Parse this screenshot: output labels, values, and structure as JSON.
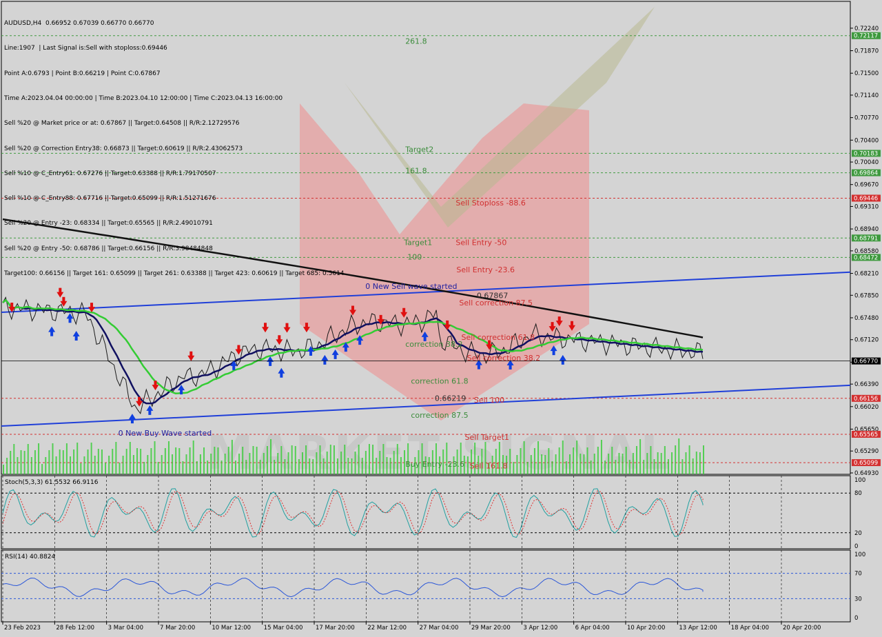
{
  "header": {
    "lines": [
      "AUDUSD,H4  0.66952 0.67039 0.66770 0.66770",
      "Line:1907  | Last Signal is:Sell with stoploss:0.69446",
      "Point A:0.6793 | Point B:0.66219 | Point C:0.67867",
      "Time A:2023.04.04 00:00:00 | Time B:2023.04.10 12:00:00 | Time C:2023.04.13 16:00:00",
      "Sell %20 @ Market price or at: 0.67867 || Target:0.64508 || R/R:2.12729576",
      "Sell %20 @ Correction Entry38: 0.66873 || Target:0.60619 || R/R:2.43062573",
      "Sell %10 @ C_Entry61: 0.67276 || Target:0.63388 || R/R:1.79170507",
      "Sell %10 @ C_Entry88: 0.67716 || Target:0.65099 || R/R:1.51271676",
      "Sell %20 @ Entry -23: 0.68334 || Target:0.65565 || R/R:2.49010791",
      "Sell %20 @ Entry -50: 0.68786 || Target:0.66156 || R/R:3.98484848",
      "Target100: 0.66156 || Target 161: 0.65099 || Target 261: 0.63388 || Target 423: 0.60619 || Target 685: 0.5614"
    ]
  },
  "chart_data": {
    "type": "line",
    "symbol": "AUDUSD,H4",
    "ohlc": {
      "open": 0.66952,
      "high": 0.67039,
      "low": 0.6677,
      "close": 0.6677
    },
    "price_axis": {
      "ylim": [
        0.6493,
        0.7242
      ],
      "ticks": [
        "0.72240",
        "0.71870",
        "0.71500",
        "0.71140",
        "0.70770",
        "0.70400",
        "0.70040",
        "0.69670",
        "0.69310",
        "0.68940",
        "0.68580",
        "0.68210",
        "0.67850",
        "0.67480",
        "0.67120",
        "0.66750",
        "0.66390",
        "0.66020",
        "0.65650",
        "0.65290",
        "0.64930"
      ]
    },
    "time_axis": [
      "23 Feb 2023",
      "28 Feb 12:00",
      "3 Mar 04:00",
      "7 Mar 20:00",
      "10 Mar 12:00",
      "15 Mar 04:00",
      "17 Mar 20:00",
      "22 Mar 12:00",
      "27 Mar 04:00",
      "29 Mar 20:00",
      "3 Apr 12:00",
      "6 Apr 04:00",
      "10 Apr 20:00",
      "13 Apr 12:00",
      "18 Apr 04:00",
      "20 Apr 20:00"
    ],
    "current_price": {
      "value": 0.6677,
      "label": "0.66770",
      "color": "#000000"
    },
    "levels": [
      {
        "value": 0.72117,
        "label": "0.72117",
        "color": "#3f9a3f",
        "dash": true
      },
      {
        "value": 0.70183,
        "label": "0.70183",
        "color": "#3f9a3f",
        "dash": true
      },
      {
        "value": 0.69864,
        "label": "0.69864",
        "color": "#3f9a3f",
        "dash": true
      },
      {
        "value": 0.69446,
        "label": "0.69446",
        "color": "#d33030",
        "dash": true
      },
      {
        "value": 0.68791,
        "label": "0.68791",
        "color": "#3f9a3f",
        "dash": true
      },
      {
        "value": 0.68472,
        "label": "0.68472",
        "color": "#3f9a3f",
        "dash": true
      },
      {
        "value": 0.66156,
        "label": "0.66156",
        "color": "#d33030",
        "dash": true
      },
      {
        "value": 0.65565,
        "label": "0.65565",
        "color": "#d33030",
        "dash": true
      },
      {
        "value": 0.65099,
        "label": "0.65099",
        "color": "#d33030",
        "dash": true
      }
    ],
    "annotations": [
      {
        "text": "261.8",
        "value": 0.7203,
        "time": 0.575,
        "color": "#3c8c3c"
      },
      {
        "text": "Target2",
        "value": 0.7025,
        "time": 0.575,
        "color": "#3c8c3c"
      },
      {
        "text": "161.8",
        "value": 0.699,
        "time": 0.575,
        "color": "#3c8c3c"
      },
      {
        "text": "Sell Stoploss -88.6",
        "value": 0.6937,
        "time": 0.647,
        "color": "#d03030"
      },
      {
        "text": "Target1",
        "value": 0.6872,
        "time": 0.573,
        "color": "#3c8c3c"
      },
      {
        "text": "Sell Entry -50",
        "value": 0.6872,
        "time": 0.647,
        "color": "#d03030"
      },
      {
        "text": "100",
        "value": 0.6848,
        "time": 0.578,
        "color": "#3c8c3c"
      },
      {
        "text": "Sell Entry -23.6",
        "value": 0.6827,
        "time": 0.648,
        "color": "#d03030"
      },
      {
        "text": "0 New Sell wave started",
        "value": 0.68,
        "time": 0.518,
        "color": "#2020a0"
      },
      {
        "text": "0.67867",
        "value": 0.6785,
        "time": 0.677,
        "color": "#303030"
      },
      {
        "text": "Sell correction 87.5",
        "value": 0.6773,
        "time": 0.652,
        "color": "#d03030"
      },
      {
        "text": "Sell correction 61.8",
        "value": 0.6716,
        "time": 0.655,
        "color": "#d03030"
      },
      {
        "text": "correction 38.2",
        "value": 0.6705,
        "time": 0.575,
        "color": "#3c8c3c"
      },
      {
        "text": "Sell correction 38.2",
        "value": 0.6682,
        "time": 0.663,
        "color": "#d03030"
      },
      {
        "text": "correction 61.8",
        "value": 0.6644,
        "time": 0.583,
        "color": "#3c8c3c"
      },
      {
        "text": "0.66219",
        "value": 0.6616,
        "time": 0.617,
        "color": "#303030"
      },
      {
        "text": "Sell 100",
        "value": 0.6613,
        "time": 0.673,
        "color": "#d03030"
      },
      {
        "text": "correction 87.5",
        "value": 0.6588,
        "time": 0.583,
        "color": "#3c8c3c"
      },
      {
        "text": "0 New Buy Wave started",
        "value": 0.6559,
        "time": 0.165,
        "color": "#2020a0"
      },
      {
        "text": "Sell Target1",
        "value": 0.6552,
        "time": 0.66,
        "color": "#d03030"
      },
      {
        "text": "Buy Entry -23.6",
        "value": 0.6508,
        "time": 0.575,
        "color": "#3c8c3c"
      },
      {
        "text": "Sell 161.8",
        "value": 0.6505,
        "time": 0.667,
        "color": "#d03030"
      }
    ],
    "trend_channel": {
      "upper": [
        [
          0,
          0.6757
        ],
        [
          1,
          0.6823
        ]
      ],
      "lower": [
        [
          0,
          0.657
        ],
        [
          1,
          0.6637
        ]
      ]
    },
    "sell_arrows": [
      0.013,
      0.082,
      0.087,
      0.127,
      0.195,
      0.218,
      0.269,
      0.337,
      0.375,
      0.395,
      0.406,
      0.434,
      0.5,
      0.54,
      0.573,
      0.635,
      0.695,
      0.785,
      0.795,
      0.813
    ],
    "buy_arrows": [
      0.07,
      0.096,
      0.105,
      0.185,
      0.21,
      0.255,
      0.33,
      0.382,
      0.398,
      0.44,
      0.46,
      0.475,
      0.49,
      0.51,
      0.603,
      0.68,
      0.725,
      0.787,
      0.8
    ],
    "stoch": {
      "label": "Stoch(5,3,3) 61.5532 66.9116",
      "k": 61.5532,
      "d": 66.9116,
      "levels": [
        80,
        20
      ],
      "ticks": [
        "100",
        "80",
        "20",
        "0"
      ]
    },
    "rsi": {
      "label": "RSI(14) 40.8824",
      "value": 40.8824,
      "levels": [
        70,
        30
      ],
      "ticks": [
        "100",
        "70",
        "30",
        "0"
      ]
    },
    "watermark": "MARKET SIGNAL"
  }
}
